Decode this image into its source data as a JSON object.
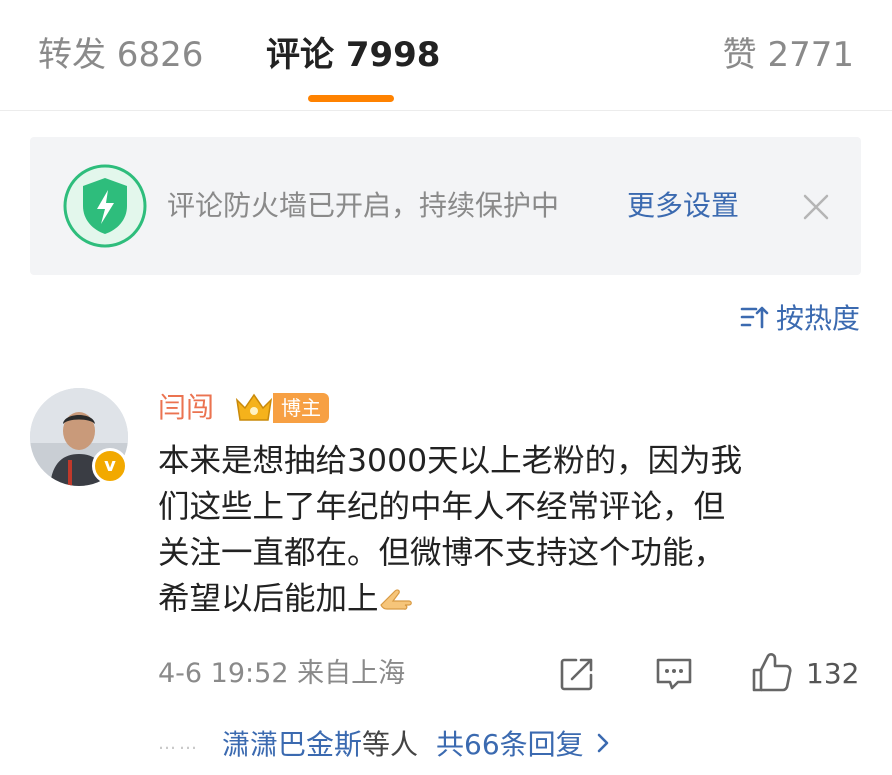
{
  "tabs": {
    "repost": "转发 6826",
    "comment": "评论 7998",
    "like": "赞 2771"
  },
  "banner": {
    "text": "评论防火墙已开启，持续保护中",
    "link": "更多设置"
  },
  "sort": {
    "label": "按热度"
  },
  "comment": {
    "username": "闫闯",
    "badge": "博主",
    "avatar_badge": "v",
    "lines": [
      "本来是想抽给3000天以上老粉的，因为我",
      "们这些上了年纪的中年人不经常评论，但",
      "关注一直都在。但微博不支持这个功能，",
      "希望以后能加上"
    ],
    "meta": "4-6 19:52 来自上海",
    "like_count": "132"
  },
  "replies": {
    "dots": "……",
    "names": "潇潇巴金斯",
    "suffix": "等人",
    "total": "共66条回复"
  },
  "colors": {
    "accent": "#ff8200",
    "link": "#3b6ab0",
    "username": "#eb7350",
    "shield": "#2ebd7c"
  },
  "icons": [
    "shield-icon",
    "close-icon",
    "sort-icon",
    "crown-icon",
    "share-icon",
    "comment-icon",
    "like-icon",
    "chevron-right-icon"
  ]
}
